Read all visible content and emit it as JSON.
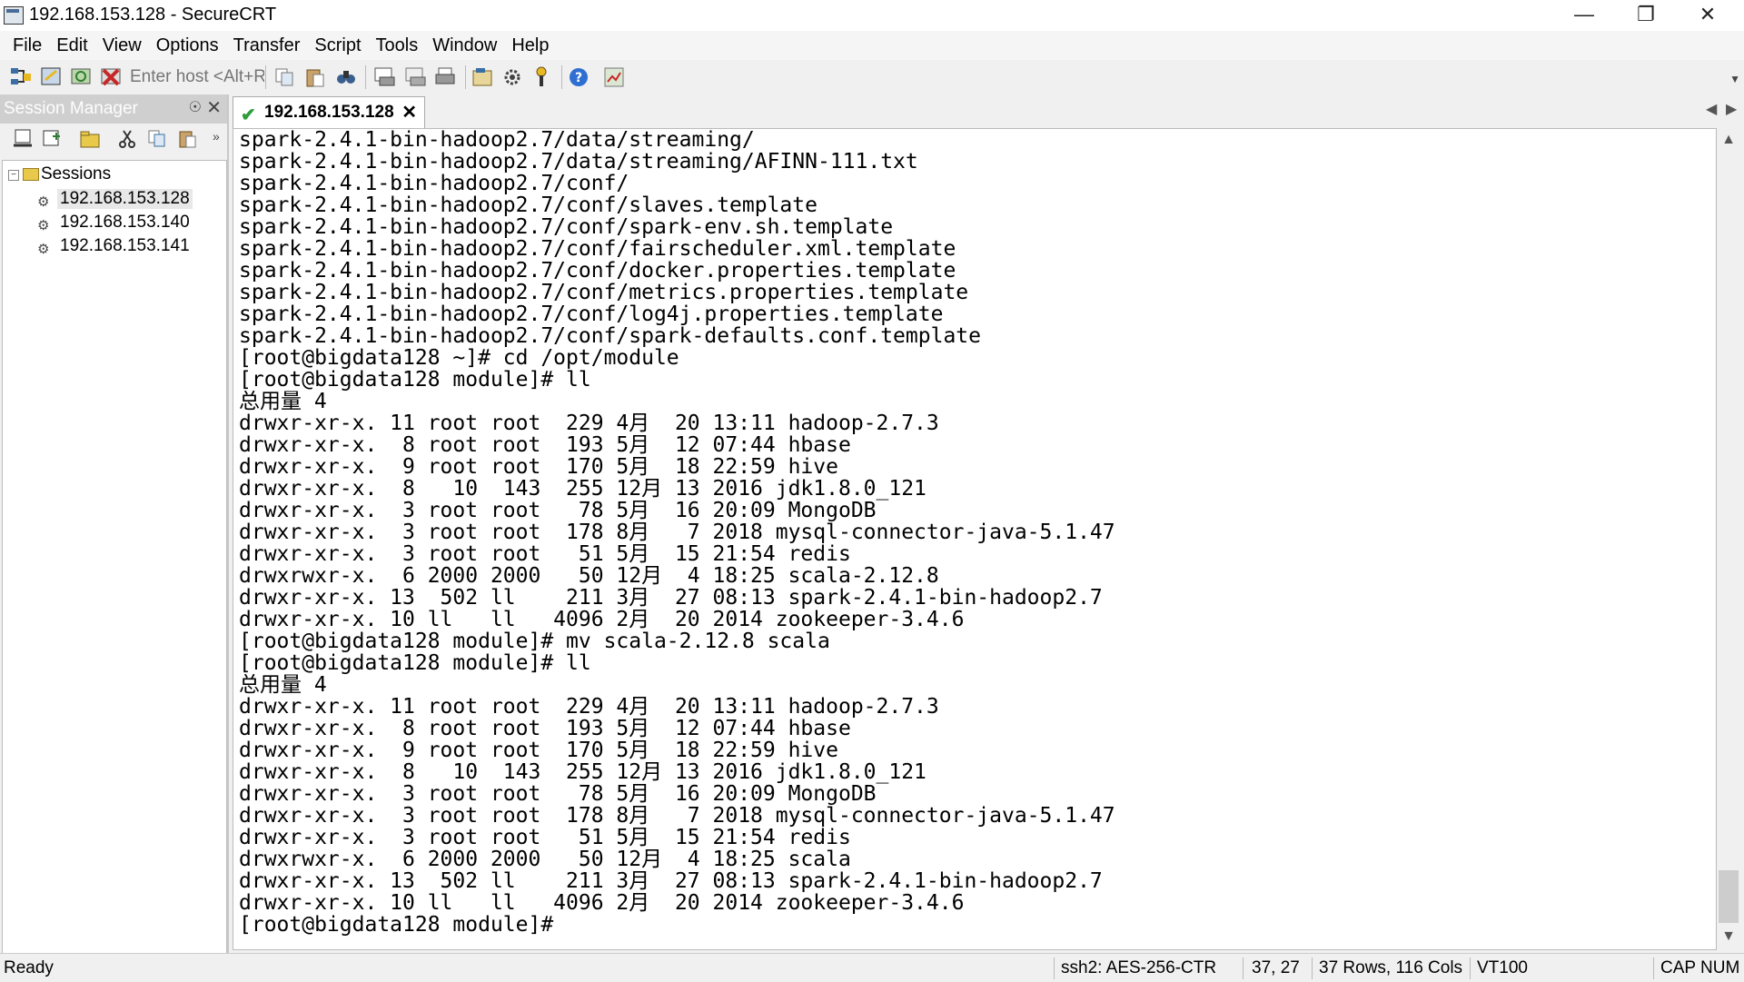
{
  "window": {
    "title": "192.168.153.128 - SecureCRT"
  },
  "menu": [
    "File",
    "Edit",
    "View",
    "Options",
    "Transfer",
    "Script",
    "Tools",
    "Window",
    "Help"
  ],
  "toolbar": {
    "host_placeholder": "Enter host <Alt+R>"
  },
  "session_manager": {
    "title": "Session Manager",
    "root": "Sessions",
    "items": [
      "192.168.153.128",
      "192.168.153.140",
      "192.168.153.141"
    ]
  },
  "tab": {
    "label": "192.168.153.128"
  },
  "terminal": {
    "lines": [
      "spark-2.4.1-bin-hadoop2.7/data/streaming/",
      "spark-2.4.1-bin-hadoop2.7/data/streaming/AFINN-111.txt",
      "spark-2.4.1-bin-hadoop2.7/conf/",
      "spark-2.4.1-bin-hadoop2.7/conf/slaves.template",
      "spark-2.4.1-bin-hadoop2.7/conf/spark-env.sh.template",
      "spark-2.4.1-bin-hadoop2.7/conf/fairscheduler.xml.template",
      "spark-2.4.1-bin-hadoop2.7/conf/docker.properties.template",
      "spark-2.4.1-bin-hadoop2.7/conf/metrics.properties.template",
      "spark-2.4.1-bin-hadoop2.7/conf/log4j.properties.template",
      "spark-2.4.1-bin-hadoop2.7/conf/spark-defaults.conf.template",
      "[root@bigdata128 ~]# cd /opt/module",
      "[root@bigdata128 module]# ll",
      "总用量 4",
      "drwxr-xr-x. 11 root root  229 4月  20 13:11 hadoop-2.7.3",
      "drwxr-xr-x.  8 root root  193 5月  12 07:44 hbase",
      "drwxr-xr-x.  9 root root  170 5月  18 22:59 hive",
      "drwxr-xr-x.  8   10  143  255 12月 13 2016 jdk1.8.0_121",
      "drwxr-xr-x.  3 root root   78 5月  16 20:09 MongoDB",
      "drwxr-xr-x.  3 root root  178 8月   7 2018 mysql-connector-java-5.1.47",
      "drwxr-xr-x.  3 root root   51 5月  15 21:54 redis",
      "drwxrwxr-x.  6 2000 2000   50 12月  4 18:25 scala-2.12.8",
      "drwxr-xr-x. 13  502 ll    211 3月  27 08:13 spark-2.4.1-bin-hadoop2.7",
      "drwxr-xr-x. 10 ll   ll   4096 2月  20 2014 zookeeper-3.4.6",
      "[root@bigdata128 module]# mv scala-2.12.8 scala",
      "[root@bigdata128 module]# ll",
      "总用量 4",
      "drwxr-xr-x. 11 root root  229 4月  20 13:11 hadoop-2.7.3",
      "drwxr-xr-x.  8 root root  193 5月  12 07:44 hbase",
      "drwxr-xr-x.  9 root root  170 5月  18 22:59 hive",
      "drwxr-xr-x.  8   10  143  255 12月 13 2016 jdk1.8.0_121",
      "drwxr-xr-x.  3 root root   78 5月  16 20:09 MongoDB",
      "drwxr-xr-x.  3 root root  178 8月   7 2018 mysql-connector-java-5.1.47",
      "drwxr-xr-x.  3 root root   51 5月  15 21:54 redis",
      "drwxrwxr-x.  6 2000 2000   50 12月  4 18:25 scala",
      "drwxr-xr-x. 13  502 ll    211 3月  27 08:13 spark-2.4.1-bin-hadoop2.7",
      "drwxr-xr-x. 10 ll   ll   4096 2月  20 2014 zookeeper-3.4.6",
      "[root@bigdata128 module]#"
    ]
  },
  "status": {
    "ready": "Ready",
    "cipher": "ssh2: AES-256-CTR",
    "cursor": "37, 27",
    "size": "37 Rows, 116 Cols",
    "emulation": "VT100",
    "keys": "CAP NUM"
  }
}
